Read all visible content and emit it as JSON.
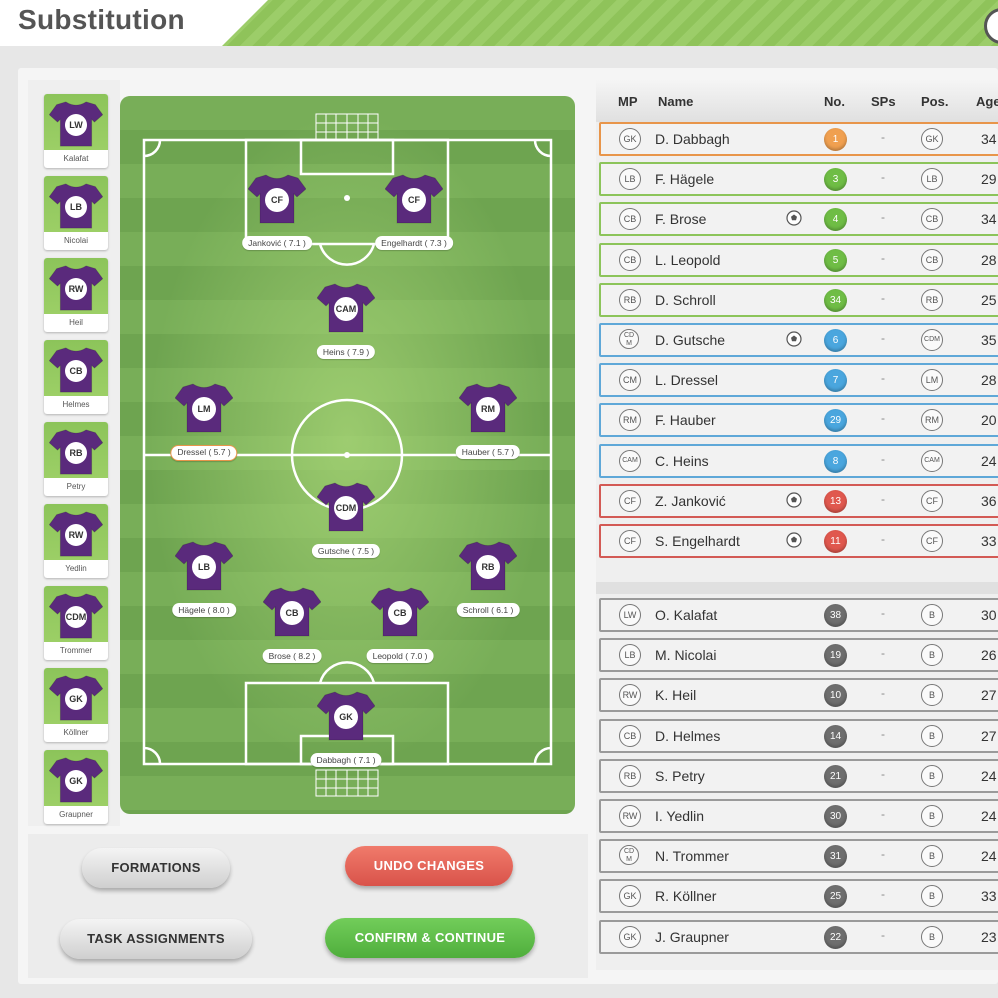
{
  "header": {
    "title": "Substitution"
  },
  "bench": [
    {
      "pos": "LW",
      "name": "Kalafat"
    },
    {
      "pos": "LB",
      "name": "Nicolai"
    },
    {
      "pos": "RW",
      "name": "Heil"
    },
    {
      "pos": "CB",
      "name": "Helmes"
    },
    {
      "pos": "RB",
      "name": "Petry"
    },
    {
      "pos": "RW",
      "name": "Yedlin"
    },
    {
      "pos": "CDM",
      "name": "Trommer"
    },
    {
      "pos": "GK",
      "name": "Köllner"
    },
    {
      "pos": "GK",
      "name": "Graupner"
    }
  ],
  "pitch": {
    "players": [
      {
        "pos": "CF",
        "label": "Janković ( 7.1 )",
        "selected": false
      },
      {
        "pos": "CF",
        "label": "Engelhardt ( 7.3 )",
        "selected": false
      },
      {
        "pos": "CAM",
        "label": "Heins ( 7.9 )",
        "selected": false
      },
      {
        "pos": "LM",
        "label": "Dressel ( 5.7 )",
        "selected": true
      },
      {
        "pos": "RM",
        "label": "Hauber ( 5.7 )",
        "selected": false
      },
      {
        "pos": "CDM",
        "label": "Gutsche ( 7.5 )",
        "selected": false
      },
      {
        "pos": "LB",
        "label": "Hägele ( 8.0 )",
        "selected": false
      },
      {
        "pos": "RB",
        "label": "Schroll ( 6.1 )",
        "selected": false
      },
      {
        "pos": "CB",
        "label": "Brose ( 8.2 )",
        "selected": false
      },
      {
        "pos": "CB",
        "label": "Leopold ( 7.0 )",
        "selected": false
      },
      {
        "pos": "GK",
        "label": "Dabbagh ( 7.1 )",
        "selected": false
      }
    ]
  },
  "buttons": {
    "formations": "FORMATIONS",
    "undo": "UNDO CHANGES",
    "tasks": "TASK ASSIGNMENTS",
    "confirm": "CONFIRM & CONTINUE"
  },
  "table": {
    "columns": {
      "mp": "MP",
      "name": "Name",
      "no": "No.",
      "sps": "SPs",
      "pos": "Pos.",
      "age": "Age"
    },
    "starters": [
      {
        "mp": "GK",
        "name": "D. Dabbagh",
        "no": "1",
        "sps": "-",
        "pos": "GK",
        "age": "34",
        "ball": false,
        "line": "#e8954a",
        "numColor": "#f0a050"
      },
      {
        "mp": "LB",
        "name": "F. Hägele",
        "no": "3",
        "sps": "-",
        "pos": "LB",
        "age": "29",
        "ball": false,
        "line": "#8cc45a",
        "numColor": "#6fbd45"
      },
      {
        "mp": "CB",
        "name": "F. Brose",
        "no": "4",
        "sps": "-",
        "pos": "CB",
        "age": "34",
        "ball": true,
        "line": "#8cc45a",
        "numColor": "#6fbd45"
      },
      {
        "mp": "CB",
        "name": "L. Leopold",
        "no": "5",
        "sps": "-",
        "pos": "CB",
        "age": "28",
        "ball": false,
        "line": "#8cc45a",
        "numColor": "#6fbd45"
      },
      {
        "mp": "RB",
        "name": "D. Schroll",
        "no": "34",
        "sps": "-",
        "pos": "RB",
        "age": "25",
        "ball": false,
        "line": "#8cc45a",
        "numColor": "#6fbd45"
      },
      {
        "mp": "CDM",
        "name": "D. Gutsche",
        "no": "6",
        "sps": "-",
        "pos": "CDM",
        "age": "35",
        "ball": true,
        "line": "#5fa8d8",
        "numColor": "#4aa6de"
      },
      {
        "mp": "CM",
        "name": "L. Dressel",
        "no": "7",
        "sps": "-",
        "pos": "LM",
        "age": "28",
        "ball": false,
        "line": "#5fa8d8",
        "numColor": "#4aa6de"
      },
      {
        "mp": "RM",
        "name": "F. Hauber",
        "no": "29",
        "sps": "-",
        "pos": "RM",
        "age": "20",
        "ball": false,
        "line": "#5fa8d8",
        "numColor": "#4aa6de"
      },
      {
        "mp": "CAM",
        "name": "C. Heins",
        "no": "8",
        "sps": "-",
        "pos": "CAM",
        "age": "24",
        "ball": false,
        "line": "#5fa8d8",
        "numColor": "#4aa6de"
      },
      {
        "mp": "CF",
        "name": "Z. Janković",
        "no": "13",
        "sps": "-",
        "pos": "CF",
        "age": "36",
        "ball": true,
        "line": "#d35a55",
        "numColor": "#e0584e"
      },
      {
        "mp": "CF",
        "name": "S. Engelhardt",
        "no": "11",
        "sps": "-",
        "pos": "CF",
        "age": "33",
        "ball": true,
        "line": "#d35a55",
        "numColor": "#e0584e"
      }
    ],
    "subs": [
      {
        "mp": "LW",
        "name": "O. Kalafat",
        "no": "38",
        "sps": "-",
        "pos": "B",
        "age": "30",
        "ball": false,
        "line": "#9a9a9a",
        "numColor": "#6e6e6e"
      },
      {
        "mp": "LB",
        "name": "M. Nicolai",
        "no": "19",
        "sps": "-",
        "pos": "B",
        "age": "26",
        "ball": false,
        "line": "#9a9a9a",
        "numColor": "#6e6e6e"
      },
      {
        "mp": "RW",
        "name": "K. Heil",
        "no": "10",
        "sps": "-",
        "pos": "B",
        "age": "27",
        "ball": false,
        "line": "#9a9a9a",
        "numColor": "#6e6e6e"
      },
      {
        "mp": "CB",
        "name": "D. Helmes",
        "no": "14",
        "sps": "-",
        "pos": "B",
        "age": "27",
        "ball": false,
        "line": "#9a9a9a",
        "numColor": "#6e6e6e"
      },
      {
        "mp": "RB",
        "name": "S. Petry",
        "no": "21",
        "sps": "-",
        "pos": "B",
        "age": "24",
        "ball": false,
        "line": "#9a9a9a",
        "numColor": "#6e6e6e"
      },
      {
        "mp": "RW",
        "name": "I. Yedlin",
        "no": "30",
        "sps": "-",
        "pos": "B",
        "age": "24",
        "ball": false,
        "line": "#9a9a9a",
        "numColor": "#6e6e6e"
      },
      {
        "mp": "CDM",
        "name": "N. Trommer",
        "no": "31",
        "sps": "-",
        "pos": "B",
        "age": "24",
        "ball": false,
        "line": "#9a9a9a",
        "numColor": "#6e6e6e"
      },
      {
        "mp": "GK",
        "name": "R. Köllner",
        "no": "25",
        "sps": "-",
        "pos": "B",
        "age": "33",
        "ball": false,
        "line": "#9a9a9a",
        "numColor": "#6e6e6e"
      },
      {
        "mp": "GK",
        "name": "J. Graupner",
        "no": "22",
        "sps": "-",
        "pos": "B",
        "age": "23",
        "ball": false,
        "line": "#9a9a9a",
        "numColor": "#6e6e6e"
      }
    ]
  },
  "colors": {
    "shirt": "#5a2a7c",
    "accent": "#8cc45a"
  },
  "icons": {
    "shirt": "jersey-icon",
    "ball": "football-icon",
    "toggle": "toggle-icon"
  }
}
